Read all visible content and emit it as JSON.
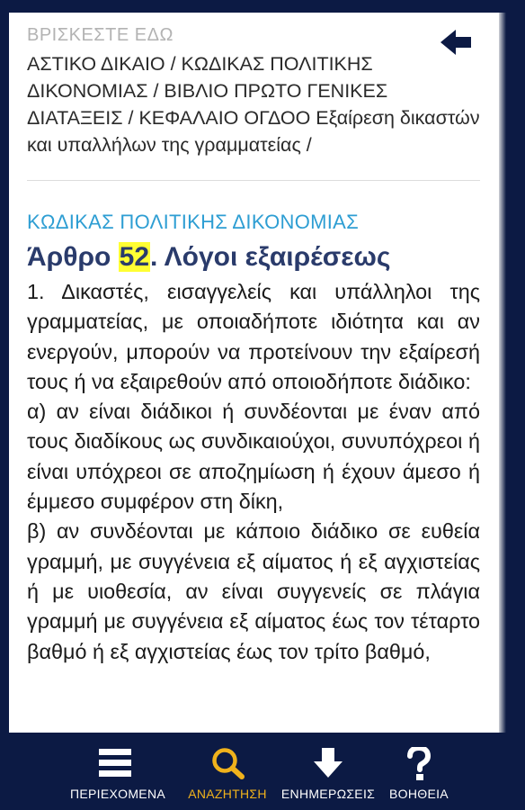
{
  "location": {
    "label": "ΒΡΙΣΚΕΣΤΕ ΕΔΩ",
    "breadcrumb": "ΑΣΤΙΚΟ ΔΙΚΑΙΟ / ΚΩΔΙΚΑΣ ΠΟΛΙΤΙΚΗΣ ΔΙΚΟΝΟΜΙΑΣ / ΒΙΒΛΙΟ ΠΡΩΤΟ ΓΕΝΙΚΕΣ ΔΙΑΤΑΞΕΙΣ / ΚΕΦΑΛΑΙΟ ΟΓΔΟΟ Εξαίρεση δικαστών και υπαλλήλων της γραμματείας /"
  },
  "article": {
    "code": "ΚΩΔΙΚΑΣ ΠΟΛΙΤΙΚΗΣ ΔΙΚΟΝΟΜΙΑΣ",
    "prefix": "Άρθρο",
    "number": "52",
    "title": ". Λόγοι εξαιρέσεως",
    "paragraphs": [
      "1. Δικαστές, εισαγγελείς και υπάλληλοι της γραμματείας, με οποιαδήποτε ιδιότητα και αν ενεργούν, μπορούν να προτείνουν την εξαίρεσή τους ή να εξαιρεθούν από οποιοδήποτε διάδικο:",
      "α) αν είναι διάδικοι ή συνδέονται με έναν από τους διαδίκους ως συνδικαιούχοι, συνυπόχρεοι ή είναι υπόχρεοι σε αποζημίωση ή έχουν άμεσο ή έμμεσο συμφέρον στη δίκη,",
      "β) αν συνδέονται με κάποιο διάδικο σε ευθεία γραμμή, με συγγένεια εξ αίματος ή εξ αγχιστείας ή με υιοθεσία, αν είναι συγγενείς σε πλάγια γραμμή με συγγένεια εξ αίματος έως τον τέταρτο βαθμό ή εξ αγχιστείας έως τον τρίτο βαθμό,"
    ]
  },
  "nav": {
    "items": [
      {
        "label": "ΠΕΡΙΕΧΟΜΕΝΑ",
        "icon": "menu-icon"
      },
      {
        "label": "ΑΝΑΖΗΤΗΣΗ",
        "icon": "search-icon"
      },
      {
        "label": "ΕΝΗΜΕΡΩΣΕΙΣ",
        "icon": "download-arrow-icon"
      },
      {
        "label": "ΒΟΗΘΕΙΑ",
        "icon": "help-icon"
      }
    ],
    "active_index": 1
  },
  "colors": {
    "background": "#0c1a44",
    "active": "#f0b21c",
    "inactive": "#ffffff",
    "code_title": "#2e9ed3",
    "article_title": "#2a3b6b",
    "highlight": "#ffff33"
  }
}
